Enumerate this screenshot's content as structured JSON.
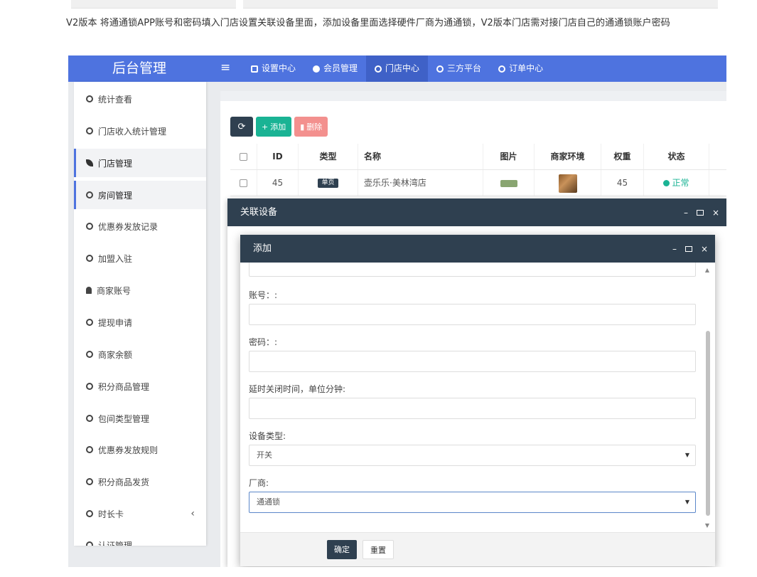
{
  "intro": {
    "text": "V2版本 将通通锁APP账号和密码填入门店设置关联设备里面，添加设备里面选择硬件厂商为通通锁，V2版本门店需对接门店自己的通通锁账户密码"
  },
  "app": {
    "brand": "后台管理",
    "accent_color": "#4e73df",
    "nav": [
      {
        "label": "设置中心",
        "icon": "gears-icon"
      },
      {
        "label": "会员管理",
        "icon": "user-circle-icon"
      },
      {
        "label": "门店中心",
        "icon": "circle-icon"
      },
      {
        "label": "三方平台",
        "icon": "circle-icon"
      },
      {
        "label": "订单中心",
        "icon": "circle-icon"
      }
    ]
  },
  "sidebar": {
    "items": [
      {
        "label": "统计查看",
        "icon": "circle-icon"
      },
      {
        "label": "门店收入统计管理",
        "icon": "circle-icon"
      },
      {
        "label": "门店管理",
        "icon": "leaf-icon"
      },
      {
        "label": "房间管理",
        "icon": "circle-icon"
      },
      {
        "label": "优惠券发放记录",
        "icon": "circle-icon"
      },
      {
        "label": "加盟入驻",
        "icon": "circle-icon"
      },
      {
        "label": "商家账号",
        "icon": "user-icon"
      },
      {
        "label": "提现申请",
        "icon": "circle-icon"
      },
      {
        "label": "商家余额",
        "icon": "circle-icon"
      },
      {
        "label": "积分商品管理",
        "icon": "circle-icon"
      },
      {
        "label": "包间类型管理",
        "icon": "circle-icon"
      },
      {
        "label": "优惠券发放规则",
        "icon": "circle-icon"
      },
      {
        "label": "积分商品发货",
        "icon": "circle-icon"
      },
      {
        "label": "时长卡",
        "icon": "circle-icon"
      },
      {
        "label": "认证管理",
        "icon": "circle-icon"
      }
    ],
    "collapse_caret": "‹"
  },
  "toolbar": {
    "refresh_icon": "⟳",
    "add_label": "添加",
    "delete_label": "删除"
  },
  "table": {
    "columns": [
      "ID",
      "类型",
      "名称",
      "图片",
      "商家环境",
      "权重",
      "状态"
    ],
    "rows": [
      {
        "id": "45",
        "type": "单页",
        "name": "壶乐乐·美林湾店",
        "weight": "45",
        "status": "正常"
      }
    ]
  },
  "layer_outer": {
    "title": "关联设备",
    "controls": {
      "min": "–",
      "close": "×"
    }
  },
  "layer_inner": {
    "title": "添加",
    "controls": {
      "min": "–",
      "close": "×"
    },
    "fields": {
      "account_label": "账号：:",
      "password_label": "密码：:",
      "delay_label": "延时关闭时间，单位分钟:",
      "device_type_label": "设备类型:",
      "device_type_value": "开关",
      "vendor_label": "厂商:",
      "vendor_value": "通通锁"
    },
    "buttons": {
      "ok": "确定",
      "reset": "重置"
    }
  }
}
